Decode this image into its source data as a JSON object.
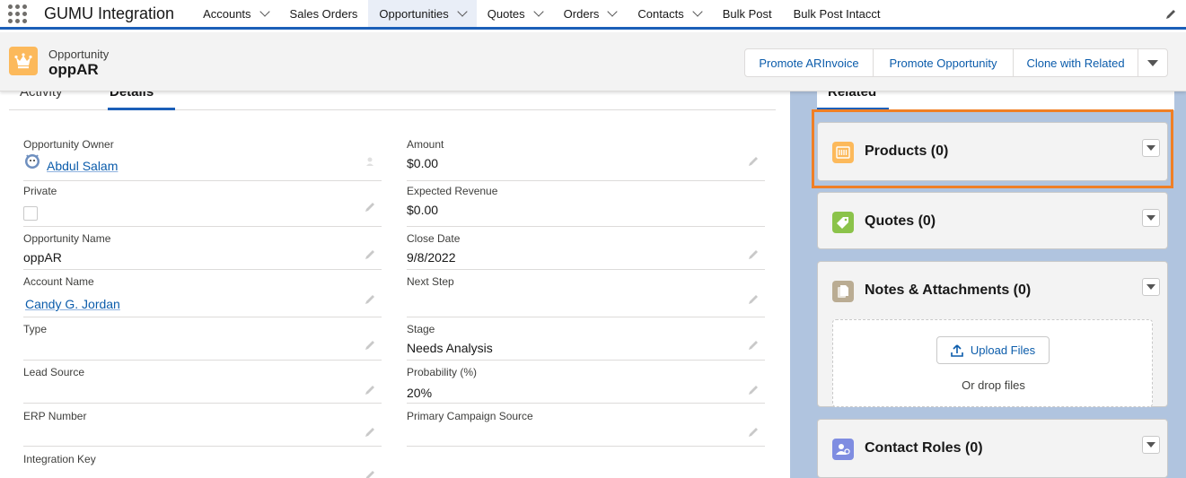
{
  "nav": {
    "app_name": "GUMU Integration",
    "items": [
      {
        "label": "Accounts",
        "dropdown": true,
        "active": false
      },
      {
        "label": "Sales Orders",
        "dropdown": false,
        "active": false
      },
      {
        "label": "Opportunities",
        "dropdown": true,
        "active": true
      },
      {
        "label": "Quotes",
        "dropdown": true,
        "active": false
      },
      {
        "label": "Orders",
        "dropdown": true,
        "active": false
      },
      {
        "label": "Contacts",
        "dropdown": true,
        "active": false
      },
      {
        "label": "Bulk Post",
        "dropdown": false,
        "active": false
      },
      {
        "label": "Bulk Post Intacct",
        "dropdown": false,
        "active": false
      }
    ]
  },
  "record": {
    "type": "Opportunity",
    "name": "oppAR",
    "icon": "crown-icon",
    "actions": [
      "Promote ARInvoice",
      "Promote Opportunity",
      "Clone with Related"
    ]
  },
  "tabs": {
    "activity": "Activity",
    "details": "Details"
  },
  "fields": {
    "owner": {
      "label": "Opportunity Owner",
      "value": "Abdul Salam"
    },
    "private": {
      "label": "Private",
      "checked": false
    },
    "opp_name": {
      "label": "Opportunity Name",
      "value": "oppAR"
    },
    "account": {
      "label": "Account Name",
      "value": "Candy G. Jordan"
    },
    "type": {
      "label": "Type",
      "value": ""
    },
    "lead_source": {
      "label": "Lead Source",
      "value": ""
    },
    "erp_number": {
      "label": "ERP Number",
      "value": ""
    },
    "integration_key": {
      "label": "Integration Key",
      "value": ""
    },
    "amount": {
      "label": "Amount",
      "value": "$0.00"
    },
    "expected_revenue": {
      "label": "Expected Revenue",
      "value": "$0.00"
    },
    "close_date": {
      "label": "Close Date",
      "value": "9/8/2022"
    },
    "next_step": {
      "label": "Next Step",
      "value": ""
    },
    "stage": {
      "label": "Stage",
      "value": "Needs Analysis"
    },
    "probability": {
      "label": "Probability (%)",
      "value": "20%"
    },
    "campaign": {
      "label": "Primary Campaign Source",
      "value": ""
    }
  },
  "related": {
    "tab": "Related",
    "products": {
      "title": "Products (0)",
      "color": "#fcb95b"
    },
    "quotes": {
      "title": "Quotes (0)",
      "color": "#8bc34a"
    },
    "notes": {
      "title": "Notes & Attachments (0)",
      "color": "#baac93",
      "upload_label": "Upload Files",
      "drop_text": "Or drop files"
    },
    "contact_roles": {
      "title": "Contact Roles (0)",
      "color": "#7f8de1"
    }
  }
}
